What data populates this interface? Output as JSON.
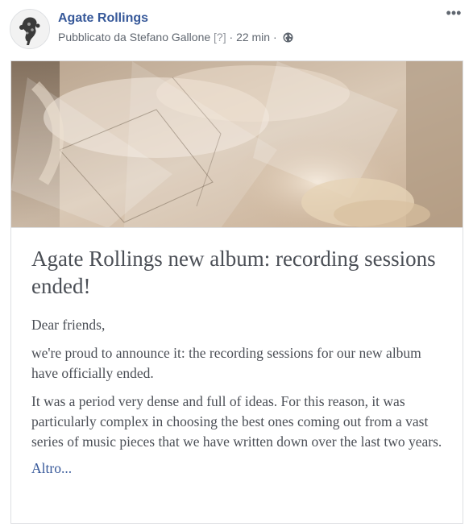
{
  "post": {
    "page_name": "Agate Rollings",
    "meta_prefix": "Pubblicato da Stefano Gallone",
    "meta_help": "[?]",
    "meta_sep": "·",
    "meta_time": "22 min",
    "meta_sep2": "·",
    "audience_icon": "globe-icon",
    "more_icon": "more-options-icon",
    "more_glyph": "•••"
  },
  "article": {
    "title": "Agate Rollings new album: recording sessions ended!",
    "paragraphs": [
      "Dear friends,",
      "we're proud to announce it: the recording sessions for our new album have officially ended.",
      "It was a period very dense and full of ideas. For this reason, it was particularly complex in choosing the best ones coming out from a vast series of music pieces that we have written down over the last two years."
    ],
    "more_link": "Altro..."
  },
  "colors": {
    "link": "#365899",
    "text": "#4b4f56",
    "meta": "#606770",
    "border": "#dddfe2"
  }
}
